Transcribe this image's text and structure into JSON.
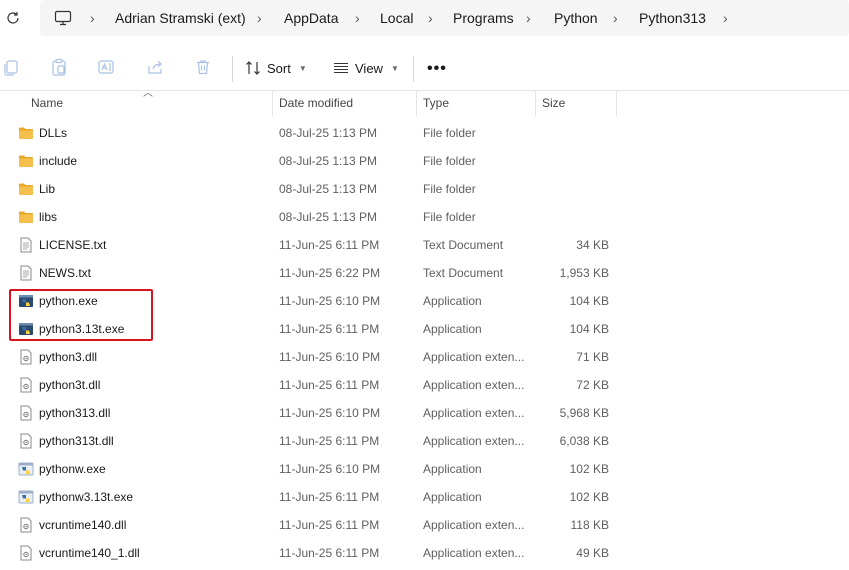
{
  "breadcrumb": {
    "items": [
      "Adrian Stramski (ext)",
      "AppData",
      "Local",
      "Programs",
      "Python",
      "Python313"
    ]
  },
  "toolbar": {
    "sort_label": "Sort",
    "view_label": "View",
    "more_label": "•••"
  },
  "columns": {
    "name": "Name",
    "date": "Date modified",
    "type": "Type",
    "size": "Size"
  },
  "files": [
    {
      "name": "DLLs",
      "date": "08-Jul-25 1:13 PM",
      "type": "File folder",
      "size": "",
      "icon": "folder-icon"
    },
    {
      "name": "include",
      "date": "08-Jul-25 1:13 PM",
      "type": "File folder",
      "size": "",
      "icon": "folder-icon"
    },
    {
      "name": "Lib",
      "date": "08-Jul-25 1:13 PM",
      "type": "File folder",
      "size": "",
      "icon": "folder-icon"
    },
    {
      "name": "libs",
      "date": "08-Jul-25 1:13 PM",
      "type": "File folder",
      "size": "",
      "icon": "folder-icon"
    },
    {
      "name": "LICENSE.txt",
      "date": "11-Jun-25 6:11 PM",
      "type": "Text Document",
      "size": "34 KB",
      "icon": "text-file-icon"
    },
    {
      "name": "NEWS.txt",
      "date": "11-Jun-25 6:22 PM",
      "type": "Text Document",
      "size": "1,953 KB",
      "icon": "text-file-icon"
    },
    {
      "name": "python.exe",
      "date": "11-Jun-25 6:10 PM",
      "type": "Application",
      "size": "104 KB",
      "icon": "python-exe-icon"
    },
    {
      "name": "python3.13t.exe",
      "date": "11-Jun-25 6:11 PM",
      "type": "Application",
      "size": "104 KB",
      "icon": "python-exe-icon"
    },
    {
      "name": "python3.dll",
      "date": "11-Jun-25 6:10 PM",
      "type": "Application exten...",
      "size": "71 KB",
      "icon": "dll-file-icon"
    },
    {
      "name": "python3t.dll",
      "date": "11-Jun-25 6:11 PM",
      "type": "Application exten...",
      "size": "72 KB",
      "icon": "dll-file-icon"
    },
    {
      "name": "python313.dll",
      "date": "11-Jun-25 6:10 PM",
      "type": "Application exten...",
      "size": "5,968 KB",
      "icon": "dll-file-icon"
    },
    {
      "name": "python313t.dll",
      "date": "11-Jun-25 6:11 PM",
      "type": "Application exten...",
      "size": "6,038 KB",
      "icon": "dll-file-icon"
    },
    {
      "name": "pythonw.exe",
      "date": "11-Jun-25 6:10 PM",
      "type": "Application",
      "size": "102 KB",
      "icon": "pythonw-exe-icon"
    },
    {
      "name": "pythonw3.13t.exe",
      "date": "11-Jun-25 6:11 PM",
      "type": "Application",
      "size": "102 KB",
      "icon": "pythonw-exe-icon"
    },
    {
      "name": "vcruntime140.dll",
      "date": "11-Jun-25 6:11 PM",
      "type": "Application exten...",
      "size": "118 KB",
      "icon": "dll-file-icon"
    },
    {
      "name": "vcruntime140_1.dll",
      "date": "11-Jun-25 6:11 PM",
      "type": "Application exten...",
      "size": "49 KB",
      "icon": "dll-file-icon"
    }
  ],
  "colors": {
    "highlight": "#d9141e",
    "folder": "#f4c04b",
    "python_blue": "#3a6ea5",
    "python_yellow": "#ffd43b"
  }
}
